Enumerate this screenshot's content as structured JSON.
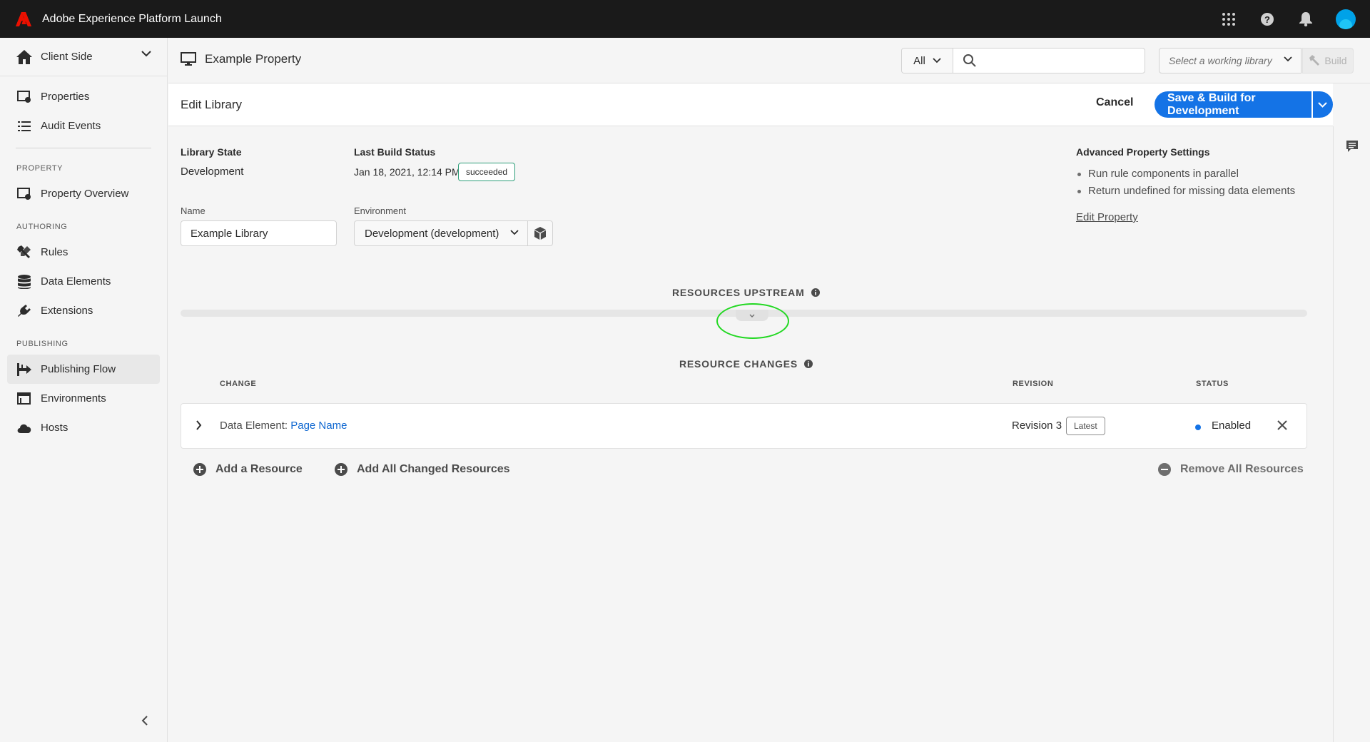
{
  "app": {
    "title": "Adobe Experience Platform Launch"
  },
  "colors": {
    "accent": "#1473e6",
    "topbar": "#1a1a1a",
    "success": "#2d9d78",
    "link": "#0d66d0",
    "highlight": "#22d822"
  },
  "sidebar": {
    "company": "Client Side",
    "items_top": [
      {
        "label": "Properties",
        "icon": "properties-icon"
      },
      {
        "label": "Audit Events",
        "icon": "list-icon"
      }
    ],
    "section_property": "PROPERTY",
    "property_items": [
      {
        "label": "Property Overview",
        "icon": "property-overview-icon"
      }
    ],
    "section_authoring": "AUTHORING",
    "authoring_items": [
      {
        "label": "Rules",
        "icon": "tools-icon"
      },
      {
        "label": "Data Elements",
        "icon": "database-icon"
      },
      {
        "label": "Extensions",
        "icon": "plug-icon"
      }
    ],
    "section_publishing": "PUBLISHING",
    "publishing_items": [
      {
        "label": "Publishing Flow",
        "icon": "publishing-flow-icon",
        "active": true
      },
      {
        "label": "Environments",
        "icon": "environments-icon"
      },
      {
        "label": "Hosts",
        "icon": "cloud-icon"
      }
    ]
  },
  "header": {
    "property_name": "Example Property",
    "search_scope": "All",
    "search_placeholder": "",
    "library_placeholder": "Select a working library",
    "build_label": "Build"
  },
  "edit": {
    "title": "Edit Library",
    "cancel_label": "Cancel",
    "save_label": "Save & Build for Development"
  },
  "library": {
    "state_label": "Library State",
    "state_value": "Development",
    "build_status_label": "Last Build Status",
    "build_date": "Jan 18, 2021, 12:14 PM",
    "build_badge": "succeeded",
    "name_label": "Name",
    "name_value": "Example Library",
    "env_label": "Environment",
    "env_value": "Development (development)"
  },
  "advanced": {
    "title": "Advanced Property Settings",
    "items": [
      "Run rule components in parallel",
      "Return undefined for missing data elements"
    ],
    "edit_link": "Edit Property"
  },
  "upstream": {
    "title": "RESOURCES UPSTREAM"
  },
  "changes": {
    "title": "RESOURCE CHANGES",
    "col_change": "CHANGE",
    "col_revision": "REVISION",
    "col_status": "STATUS",
    "rows": [
      {
        "type": "Data Element:",
        "name": "Page Name",
        "revision": "Revision 3",
        "badge": "Latest",
        "status": "Enabled"
      }
    ],
    "add_resource": "Add a Resource",
    "add_all": "Add All Changed Resources",
    "remove_all": "Remove All Resources"
  }
}
